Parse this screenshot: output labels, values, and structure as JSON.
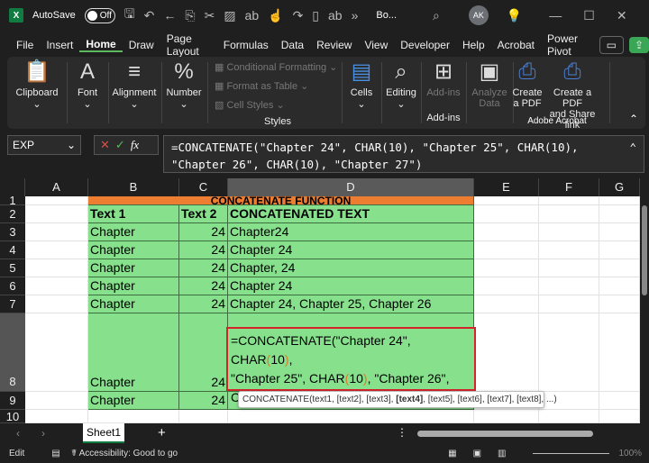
{
  "titlebar": {
    "autosave": "AutoSave",
    "toggle": "Off",
    "filename": "Bo...",
    "avatar": "AK"
  },
  "menu": [
    "File",
    "Insert",
    "Home",
    "Draw",
    "Page Layout",
    "Formulas",
    "Data",
    "Review",
    "View",
    "Developer",
    "Help",
    "Acrobat",
    "Power Pivot"
  ],
  "ribbon": {
    "clipboard": "Clipboard",
    "font": "Font",
    "alignment": "Alignment",
    "number": "Number",
    "cond_format": "Conditional Formatting",
    "format_table": "Format as Table",
    "cell_styles": "Cell Styles",
    "styles": "Styles",
    "cells": "Cells",
    "editing": "Editing",
    "addins": "Add-ins",
    "addins_group": "Add-ins",
    "analyze1": "Analyze",
    "analyze2": "Data",
    "create1": "Create",
    "create2": "a PDF",
    "share1": "Create a PDF",
    "share2": "and Share link",
    "acrobat_group": "Adobe Acrobat"
  },
  "formula_bar": {
    "name_box": "EXP",
    "formula_line1": "=CONCATENATE(\"Chapter 24\", CHAR(10), \"Chapter 25\", CHAR(10),",
    "formula_line2": "\"Chapter 26\", CHAR(10), \"Chapter 27\")"
  },
  "columns": [
    "A",
    "B",
    "C",
    "D",
    "E",
    "F",
    "G"
  ],
  "rows": [
    "1",
    "2",
    "3",
    "4",
    "5",
    "6",
    "7",
    "8",
    "9",
    "10"
  ],
  "table": {
    "title": "CONCATENATE FUNCTION",
    "headers": [
      "Text 1",
      "Text 2",
      "CONCATENATED TEXT"
    ],
    "rows": [
      [
        "Chapter",
        "24",
        "Chapter24"
      ],
      [
        "Chapter",
        "24",
        "Chapter 24"
      ],
      [
        "Chapter",
        "24",
        "Chapter, 24"
      ],
      [
        "Chapter",
        "24",
        "Chapter 24"
      ],
      [
        "Chapter",
        "24",
        "Chapter 24, Chapter 25, Chapter 26"
      ],
      [
        "Chapter",
        "24",
        ""
      ],
      [
        "Chapter",
        "24",
        ""
      ]
    ]
  },
  "edit_cell": {
    "l1a": "=CONCATENATE(\"Chapter 24\", CHAR",
    "l1b": "10",
    "l1c": ",",
    "l2a": "\"Chapter 25\", CHAR",
    "l2b": "10",
    "l2c": ", \"Chapter 26\",",
    "l3a": "CHAR",
    "l3b": "10",
    "l3c": ", \"Chapter 27\")"
  },
  "tooltip": {
    "pre": "CONCATENATE(text1, [text2], [text3], ",
    "bold": "[text4]",
    "post": ", [text5], [text6], [text7], [text8], ...)"
  },
  "sheet_tabs": {
    "active": "Sheet1",
    "add": "+"
  },
  "status": {
    "mode": "Edit",
    "accessibility": "Accessibility: Good to go",
    "zoom": "100%"
  },
  "colors": {
    "header_fill": "#86e08c",
    "title_fill": "#ed7d31",
    "edit_border": "#d1242b",
    "accent": "#107c41"
  }
}
